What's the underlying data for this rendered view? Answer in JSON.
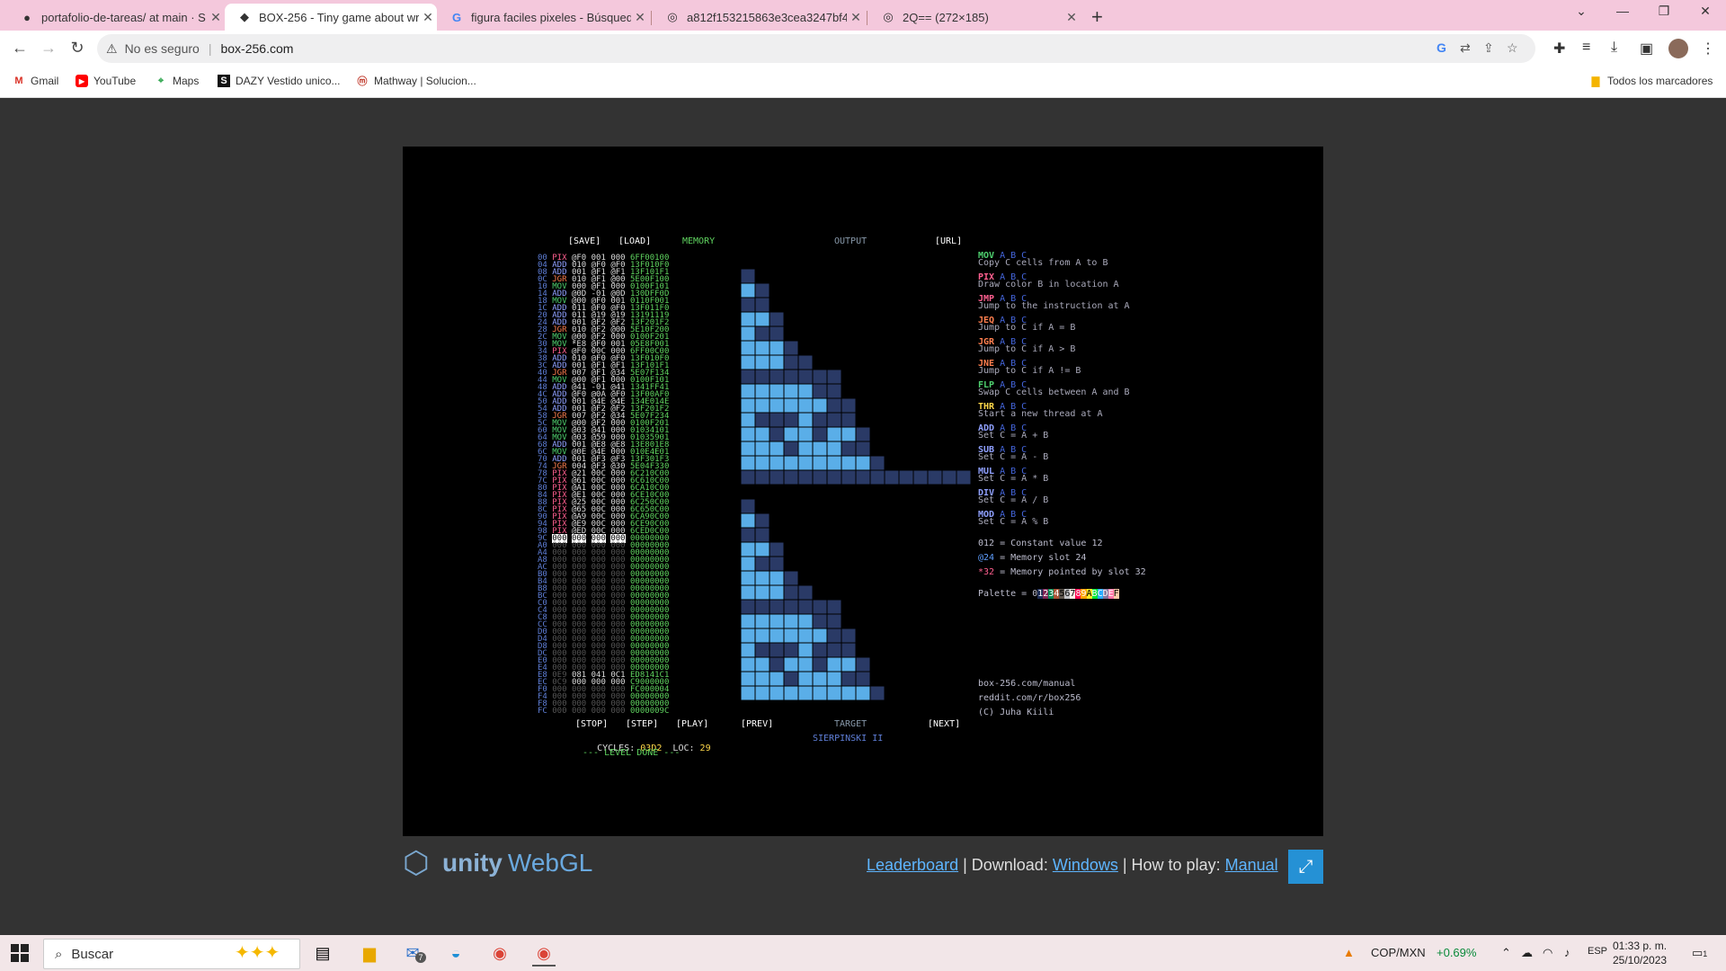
{
  "browser": {
    "tabs": [
      {
        "icon": "github-icon",
        "title": "portafolio-de-tareas/ at main · S"
      },
      {
        "icon": "unity-icon",
        "title": "BOX-256 - Tiny game about writ"
      },
      {
        "icon": "google-icon",
        "title": "figura faciles pixeles - Búsqueda"
      },
      {
        "icon": "globe-icon",
        "title": "a812f153215863e3cea3247bf4e"
      },
      {
        "icon": "globe-icon",
        "title": "2Q== (272×185)"
      }
    ],
    "security_text": "No es seguro",
    "url": "box-256.com",
    "bookmarks": [
      "Gmail",
      "YouTube",
      "Maps",
      "DAZY Vestido unico...",
      "Mathway | Solucion..."
    ],
    "all_bookmarks": "Todos los marcadores"
  },
  "game": {
    "header": {
      "save": "[SAVE]",
      "load": "[LOAD]",
      "memory": "MEMORY",
      "output": "OUTPUT",
      "url": "[URL]"
    },
    "colors": {
      "grid_bg": "#3a4d78",
      "pixel_dark": "#2a3a66",
      "pixel_light": "#5aaee8",
      "grid_line": "#000000"
    },
    "program": [
      {
        "addr": "00",
        "op": "PIX",
        "a": "@F0",
        "b": "001",
        "c": "000",
        "mem": "6FF00100"
      },
      {
        "addr": "04",
        "op": "ADD",
        "a": "010",
        "b": "@F0",
        "c": "@F0",
        "mem": "13F010F0"
      },
      {
        "addr": "08",
        "op": "ADD",
        "a": "001",
        "b": "@F1",
        "c": "@F1",
        "mem": "13F101F1"
      },
      {
        "addr": "0C",
        "op": "JGR",
        "a": "010",
        "b": "@F1",
        "c": "@00",
        "mem": "5E00F100"
      },
      {
        "addr": "10",
        "op": "MOV",
        "a": "000",
        "b": "@F1",
        "c": "000",
        "mem": "0100F101"
      },
      {
        "addr": "14",
        "op": "ADD",
        "a": "@0D",
        "b": "-01",
        "c": "@0D",
        "mem": "130DFF0D"
      },
      {
        "addr": "18",
        "op": "MOV",
        "a": "@00",
        "b": "@F0",
        "c": "001",
        "mem": "0110F001"
      },
      {
        "addr": "1C",
        "op": "ADD",
        "a": "011",
        "b": "@F0",
        "c": "@F0",
        "mem": "13F011F0"
      },
      {
        "addr": "20",
        "op": "ADD",
        "a": "011",
        "b": "@19",
        "c": "@19",
        "mem": "13191119"
      },
      {
        "addr": "24",
        "op": "ADD",
        "a": "001",
        "b": "@F2",
        "c": "@F2",
        "mem": "13F201F2"
      },
      {
        "addr": "28",
        "op": "JGR",
        "a": "010",
        "b": "@F2",
        "c": "@00",
        "mem": "5E10F200"
      },
      {
        "addr": "2C",
        "op": "MOV",
        "a": "@00",
        "b": "@F2",
        "c": "000",
        "mem": "0100F201"
      },
      {
        "addr": "30",
        "op": "MOV",
        "a": "*E8",
        "b": "@F0",
        "c": "001",
        "mem": "05E8F001"
      },
      {
        "addr": "34",
        "op": "PIX",
        "a": "@F0",
        "b": "00C",
        "c": "000",
        "mem": "6FF00C00"
      },
      {
        "addr": "38",
        "op": "ADD",
        "a": "010",
        "b": "@F0",
        "c": "@F0",
        "mem": "13F010F0"
      },
      {
        "addr": "3C",
        "op": "ADD",
        "a": "001",
        "b": "@F1",
        "c": "@F1",
        "mem": "13F101F1"
      },
      {
        "addr": "40",
        "op": "JGR",
        "a": "007",
        "b": "@F1",
        "c": "@34",
        "mem": "5E07F134"
      },
      {
        "addr": "44",
        "op": "MOV",
        "a": "@00",
        "b": "@F1",
        "c": "000",
        "mem": "0100F101"
      },
      {
        "addr": "48",
        "op": "ADD",
        "a": "@41",
        "b": "-01",
        "c": "@41",
        "mem": "1341FF41"
      },
      {
        "addr": "4C",
        "op": "ADD",
        "a": "@F0",
        "b": "@0A",
        "c": "@F0",
        "mem": "13F00AF0"
      },
      {
        "addr": "50",
        "op": "ADD",
        "a": "001",
        "b": "@4E",
        "c": "@4E",
        "mem": "134E014E"
      },
      {
        "addr": "54",
        "op": "ADD",
        "a": "001",
        "b": "@F2",
        "c": "@F2",
        "mem": "13F201F2"
      },
      {
        "addr": "58",
        "op": "JGR",
        "a": "007",
        "b": "@F2",
        "c": "@34",
        "mem": "5E07F234"
      },
      {
        "addr": "5C",
        "op": "MOV",
        "a": "@00",
        "b": "@F2",
        "c": "000",
        "mem": "0100F201"
      },
      {
        "addr": "60",
        "op": "MOV",
        "a": "@03",
        "b": "@41",
        "c": "000",
        "mem": "01034101"
      },
      {
        "addr": "64",
        "op": "MOV",
        "a": "@03",
        "b": "@59",
        "c": "000",
        "mem": "01035901"
      },
      {
        "addr": "68",
        "op": "ADD",
        "a": "001",
        "b": "@E8",
        "c": "@E8",
        "mem": "13E801E8"
      },
      {
        "addr": "6C",
        "op": "MOV",
        "a": "@0E",
        "b": "@4E",
        "c": "000",
        "mem": "010E4E01"
      },
      {
        "addr": "70",
        "op": "ADD",
        "a": "001",
        "b": "@F3",
        "c": "@F3",
        "mem": "13F301F3"
      },
      {
        "addr": "74",
        "op": "JGR",
        "a": "004",
        "b": "@F3",
        "c": "@30",
        "mem": "5E04F330"
      },
      {
        "addr": "78",
        "op": "PIX",
        "a": "@21",
        "b": "00C",
        "c": "000",
        "mem": "6C210C00"
      },
      {
        "addr": "7C",
        "op": "PIX",
        "a": "@61",
        "b": "00C",
        "c": "000",
        "mem": "6C610C00"
      },
      {
        "addr": "80",
        "op": "PIX",
        "a": "@A1",
        "b": "00C",
        "c": "000",
        "mem": "6CA10C00"
      },
      {
        "addr": "84",
        "op": "PIX",
        "a": "@E1",
        "b": "00C",
        "c": "000",
        "mem": "6CE10C00"
      },
      {
        "addr": "88",
        "op": "PIX",
        "a": "@25",
        "b": "00C",
        "c": "000",
        "mem": "6C250C00"
      },
      {
        "addr": "8C",
        "op": "PIX",
        "a": "@65",
        "b": "00C",
        "c": "000",
        "mem": "6C650C00"
      },
      {
        "addr": "90",
        "op": "PIX",
        "a": "@A9",
        "b": "00C",
        "c": "000",
        "mem": "6CA90C00"
      },
      {
        "addr": "94",
        "op": "PIX",
        "a": "@E9",
        "b": "00C",
        "c": "000",
        "mem": "6CE90C00"
      },
      {
        "addr": "98",
        "op": "PIX",
        "a": "@ED",
        "b": "00C",
        "c": "000",
        "mem": "6CED0C00"
      },
      {
        "addr": "9C",
        "op": "000",
        "a": "000",
        "b": "000",
        "c": "000",
        "mem": "00000000",
        "selected": true
      },
      {
        "addr": "A0",
        "op": "000",
        "a": "000",
        "b": "000",
        "c": "000",
        "mem": "00000000"
      },
      {
        "addr": "A4",
        "op": "000",
        "a": "000",
        "b": "000",
        "c": "000",
        "mem": "00000000"
      },
      {
        "addr": "A8",
        "op": "000",
        "a": "000",
        "b": "000",
        "c": "000",
        "mem": "00000000"
      },
      {
        "addr": "AC",
        "op": "000",
        "a": "000",
        "b": "000",
        "c": "000",
        "mem": "00000000"
      },
      {
        "addr": "B0",
        "op": "000",
        "a": "000",
        "b": "000",
        "c": "000",
        "mem": "00000000"
      },
      {
        "addr": "B4",
        "op": "000",
        "a": "000",
        "b": "000",
        "c": "000",
        "mem": "00000000"
      },
      {
        "addr": "B8",
        "op": "000",
        "a": "000",
        "b": "000",
        "c": "000",
        "mem": "00000000"
      },
      {
        "addr": "BC",
        "op": "000",
        "a": "000",
        "b": "000",
        "c": "000",
        "mem": "00000000"
      },
      {
        "addr": "C0",
        "op": "000",
        "a": "000",
        "b": "000",
        "c": "000",
        "mem": "00000000"
      },
      {
        "addr": "C4",
        "op": "000",
        "a": "000",
        "b": "000",
        "c": "000",
        "mem": "00000000"
      },
      {
        "addr": "C8",
        "op": "000",
        "a": "000",
        "b": "000",
        "c": "000",
        "mem": "00000000"
      },
      {
        "addr": "CC",
        "op": "000",
        "a": "000",
        "b": "000",
        "c": "000",
        "mem": "00000000"
      },
      {
        "addr": "D0",
        "op": "000",
        "a": "000",
        "b": "000",
        "c": "000",
        "mem": "00000000"
      },
      {
        "addr": "D4",
        "op": "000",
        "a": "000",
        "b": "000",
        "c": "000",
        "mem": "00000000"
      },
      {
        "addr": "D8",
        "op": "000",
        "a": "000",
        "b": "000",
        "c": "000",
        "mem": "00000000"
      },
      {
        "addr": "DC",
        "op": "000",
        "a": "000",
        "b": "000",
        "c": "000",
        "mem": "00000000"
      },
      {
        "addr": "E0",
        "op": "000",
        "a": "000",
        "b": "000",
        "c": "000",
        "mem": "00000000"
      },
      {
        "addr": "E4",
        "op": "000",
        "a": "000",
        "b": "000",
        "c": "000",
        "mem": "00000000"
      },
      {
        "addr": "E8",
        "op": "0E9",
        "a": "081",
        "b": "041",
        "c": "0C1",
        "mem": "ED8141C1"
      },
      {
        "addr": "EC",
        "op": "0C9",
        "a": "000",
        "b": "000",
        "c": "000",
        "mem": "C9000000"
      },
      {
        "addr": "F0",
        "op": "000",
        "a": "000",
        "b": "000",
        "c": "000",
        "mem": "FC000004"
      },
      {
        "addr": "F4",
        "op": "000",
        "a": "000",
        "b": "000",
        "c": "000",
        "mem": "00000000"
      },
      {
        "addr": "F8",
        "op": "000",
        "a": "000",
        "b": "000",
        "c": "000",
        "mem": "00000000"
      },
      {
        "addr": "FC",
        "op": "000",
        "a": "000",
        "b": "000",
        "c": "000",
        "mem": "0000009C"
      }
    ],
    "output_pixels": [
      "................",
      "#...............",
      "B#..............",
      "##..............",
      "BB#.............",
      "B##.............",
      "BBB#............",
      "BBB##...........",
      "#######.........",
      "BBBBB##.........",
      "BBBBBB##........",
      "B###B###........",
      "BB#BB#BB#.......",
      "BBB#BBB##.......",
      "BBBBBBBBB#......",
      "################",
      "................",
      "#...............",
      "B#..............",
      "##..............",
      "BB#.............",
      "B##.............",
      "BBB#............",
      "BBB##...........",
      "#######.........",
      "BBBBB##.........",
      "BBBBBB##........",
      "B###B###........",
      "BB#BB#BB#.......",
      "BBB#BBB##.......",
      "BBBBBBBBB#......",
      "................"
    ],
    "reference": [
      {
        "op": "MOV",
        "color": "#4fd06f",
        "desc": "Copy C cells from A to B"
      },
      {
        "op": "PIX",
        "color": "#ff5f8f",
        "desc": "Draw color B in location A"
      },
      {
        "op": "JMP",
        "color": "#ff5f8f",
        "desc": "Jump to the instruction at A"
      },
      {
        "op": "JEQ",
        "color": "#ff7f4f",
        "desc": "Jump to C if A = B"
      },
      {
        "op": "JGR",
        "color": "#ff7f4f",
        "desc": "Jump to C if A > B"
      },
      {
        "op": "JNE",
        "color": "#ff7f4f",
        "desc": "Jump to C if A != B"
      },
      {
        "op": "FLP",
        "color": "#4fd06f",
        "desc": "Swap C cells between A and B"
      },
      {
        "op": "THR",
        "color": "#ffd84a",
        "desc": "Start a new thread at A"
      },
      {
        "op": "ADD",
        "color": "#8fa0ff",
        "desc": "Set C = A + B"
      },
      {
        "op": "SUB",
        "color": "#8fa0ff",
        "desc": "Set C = A - B"
      },
      {
        "op": "MUL",
        "color": "#8fa0ff",
        "desc": "Set C = A * B"
      },
      {
        "op": "DIV",
        "color": "#8fa0ff",
        "desc": "Set C = A / B"
      },
      {
        "op": "MOD",
        "color": "#8fa0ff",
        "desc": "Set C = A % B"
      }
    ],
    "ref_args": "A B C",
    "legend": [
      {
        "key": "012",
        "desc": "=  Constant value 12"
      },
      {
        "key": "@24",
        "desc": "=  Memory slot 24"
      },
      {
        "key": "*32",
        "desc": "=  Memory pointed by slot 32"
      }
    ],
    "palette_label": "Palette = 0",
    "palette_chars": [
      "1",
      "2",
      "3",
      "4",
      "5",
      "6",
      "7",
      "8",
      "9",
      "A",
      "B",
      "C",
      "D",
      "E",
      "F"
    ],
    "palette_colors": [
      "#1d2b53",
      "#7e2553",
      "#008751",
      "#ab5236",
      "#5f574f",
      "#c2c3c7",
      "#fff1e8",
      "#ff004d",
      "#ffa300",
      "#ffec27",
      "#00e436",
      "#29adff",
      "#83769c",
      "#ff77a8",
      "#ffccaa"
    ],
    "links": [
      "box-256.com/manual",
      "reddit.com/r/box256",
      "(C) Juha Kiili"
    ],
    "controls": {
      "stop": "[STOP]",
      "step": "[STEP]",
      "play": "[PLAY]",
      "prev": "[PREV]",
      "target": "TARGET",
      "next": "[NEXT]"
    },
    "cycles_label": "CYCLES:",
    "cycles": "03D2",
    "loc_label": "LOC:",
    "loc": "29",
    "level_done": "--- LEVEL DONE ---",
    "target_name": "SIERPINSKI II"
  },
  "page": {
    "unity_logo_text": "unity",
    "webgl_text": "WebGL",
    "leaderboard": "Leaderboard",
    "sep1": " | Download: ",
    "windows": "Windows",
    "sep2": " | How to play: ",
    "manual": "Manual"
  },
  "taskbar": {
    "search": "Buscar",
    "currency": "COP/MXN",
    "change": "+0.69%",
    "lang": "ESP",
    "time": "01:33 p. m.",
    "date": "25/10/2023",
    "mail_badge": "7",
    "notif_badge": "1"
  }
}
